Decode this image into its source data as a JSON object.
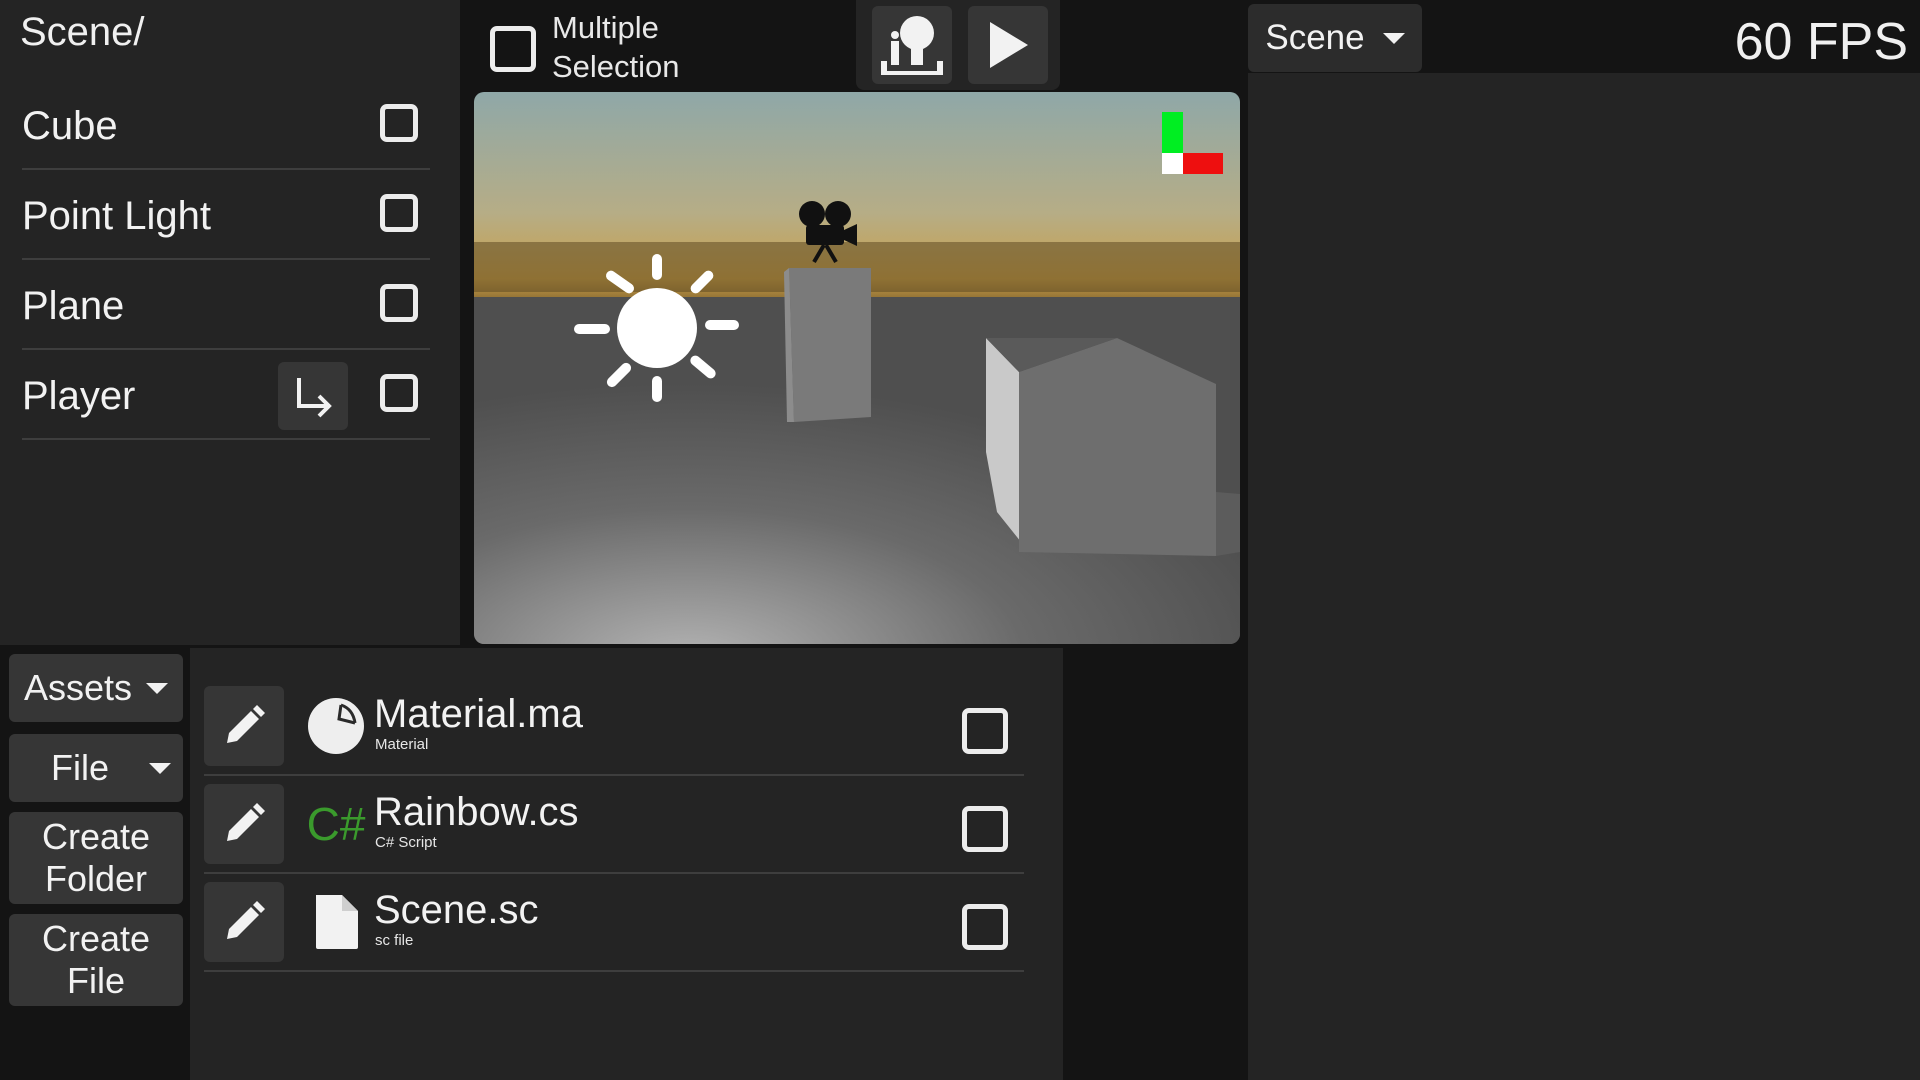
{
  "hierarchy": {
    "path": "Scene/",
    "items": [
      {
        "label": "Cube"
      },
      {
        "label": "Point Light"
      },
      {
        "label": "Plane"
      },
      {
        "label": "Player",
        "reparent_icon": "arrow-turn-down-right-icon"
      }
    ]
  },
  "toolbar": {
    "multiple_selection_label": "Multiple\nSelection",
    "camera_icon": "camera-view-icon",
    "play_icon": "play-icon"
  },
  "scene_dropdown": {
    "label": "Scene"
  },
  "fps": "60 FPS",
  "assets_panel": {
    "assets_dropdown": "Assets",
    "file_dropdown": "File",
    "create_folder": "Create\nFolder",
    "create_file": "Create\nFile",
    "items": [
      {
        "name": "Material.ma",
        "type": "Material",
        "icon": "material-sphere-icon"
      },
      {
        "name": "Rainbow.cs",
        "type": "C# Script",
        "icon": "csharp-icon",
        "icon_text": "C#",
        "icon_color": "#3a9a2c"
      },
      {
        "name": "Scene.sc",
        "type": "sc file",
        "icon": "file-icon"
      }
    ]
  },
  "viewport": {
    "axis_colors": {
      "y": "#00ee22",
      "x": "#ee0f0f",
      "origin": "#ffffff"
    },
    "sky_top": "#8fa8a8",
    "horizon": "#c9a04a",
    "ground": "#4f4f4f"
  }
}
